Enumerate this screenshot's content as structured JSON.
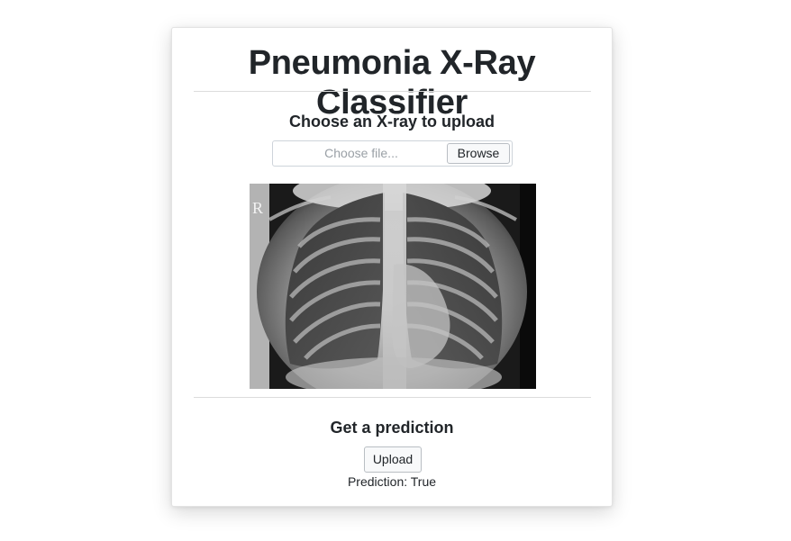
{
  "page": {
    "title": "Pneumonia X-Ray Classifier"
  },
  "upload_section": {
    "heading": "Choose an X-ray to upload",
    "file_placeholder": "Choose file...",
    "browse_label": "Browse",
    "image_marker": "R"
  },
  "predict_section": {
    "heading": "Get a prediction",
    "upload_label": "Upload",
    "prediction_text": "Prediction: True"
  },
  "colors": {
    "text": "#212529",
    "placeholder": "#9aa0a6",
    "button_bg": "#f8f9fa",
    "border": "#ced4da"
  }
}
